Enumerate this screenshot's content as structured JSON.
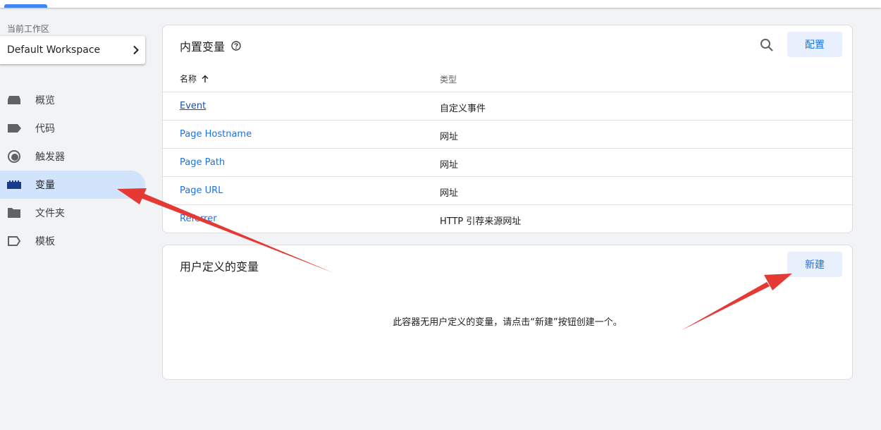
{
  "sidebar": {
    "workspace_label": "当前工作区",
    "workspace_name": "Default Workspace",
    "items": [
      {
        "label": "概览",
        "icon": "overview-icon"
      },
      {
        "label": "代码",
        "icon": "tag-icon"
      },
      {
        "label": "触发器",
        "icon": "trigger-icon"
      },
      {
        "label": "变量",
        "icon": "variable-icon",
        "active": true
      },
      {
        "label": "文件夹",
        "icon": "folder-icon"
      },
      {
        "label": "模板",
        "icon": "template-icon"
      }
    ]
  },
  "builtin": {
    "title": "内置变量",
    "configure_label": "配置",
    "columns": {
      "name": "名称",
      "type": "类型"
    },
    "rows": [
      {
        "name": "Event",
        "type": "自定义事件"
      },
      {
        "name": "Page Hostname",
        "type": "网址"
      },
      {
        "name": "Page Path",
        "type": "网址"
      },
      {
        "name": "Page URL",
        "type": "网址"
      },
      {
        "name": "Referrer",
        "type": "HTTP 引荐来源网址"
      }
    ]
  },
  "user_defined": {
    "title": "用户定义的变量",
    "new_label": "新建",
    "empty_message": "此容器无用户定义的变量，请点击“新建”按钮创建一个。"
  },
  "colors": {
    "accent": "#1a73e8",
    "active_nav_bg": "#d2e3fc",
    "button_bg": "#e8f0fe",
    "annotation_arrow": "#e53935"
  }
}
